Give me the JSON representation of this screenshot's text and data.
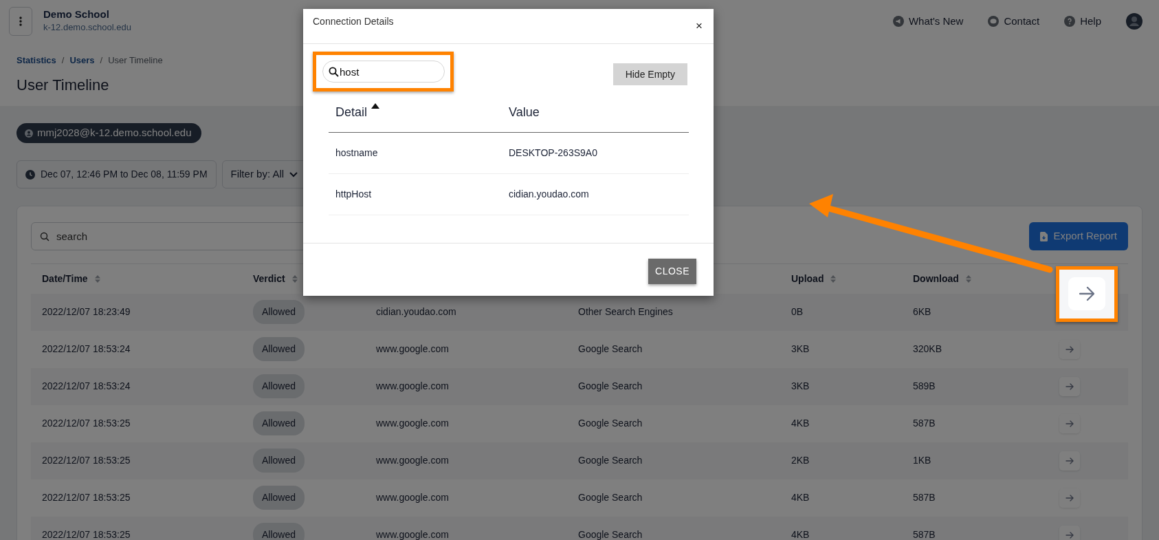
{
  "header": {
    "org_name": "Demo School",
    "org_domain": "k-12.demo.school.edu",
    "links": [
      {
        "label": "What's New",
        "kind": "news"
      },
      {
        "label": "Contact",
        "kind": "chat"
      },
      {
        "label": "Help",
        "kind": "help"
      }
    ]
  },
  "breadcrumb": [
    {
      "label": "Statistics",
      "current": false
    },
    {
      "label": "Users",
      "current": false,
      "separator": "/"
    },
    {
      "label": "User Timeline",
      "current": true,
      "separator": "/"
    }
  ],
  "title": "User Timeline",
  "user_chip": "mmj2028@k-12.demo.school.edu",
  "date_range": "Dec 07, 12:46 PM to Dec 08, 11:59 PM",
  "filter": "Filter by: All",
  "search": {
    "placeholder": "search"
  },
  "export_button": "Export Report",
  "table": {
    "columns": [
      {
        "label": "Date/Time"
      },
      {
        "label": "Verdict"
      },
      {
        "label": "Upload"
      },
      {
        "label": "Download"
      }
    ],
    "rows": [
      {
        "date_time": "2022/12/07 18:23:49",
        "verdict": "Allowed",
        "domain": "cidian.youdao.com",
        "category": "Other Search Engines",
        "upload": "0B",
        "download": "6KB",
        "highlighted": true
      },
      {
        "date_time": "2022/12/07 18:53:24",
        "verdict": "Allowed",
        "domain": "www.google.com",
        "category": "Google Search",
        "upload": "3KB",
        "download": "320KB",
        "highlighted": false
      },
      {
        "date_time": "2022/12/07 18:53:24",
        "verdict": "Allowed",
        "domain": "www.google.com",
        "category": "Google Search",
        "upload": "3KB",
        "download": "589B",
        "highlighted": false
      },
      {
        "date_time": "2022/12/07 18:53:25",
        "verdict": "Allowed",
        "domain": "www.google.com",
        "category": "Google Search",
        "upload": "4KB",
        "download": "587B",
        "highlighted": false
      },
      {
        "date_time": "2022/12/07 18:53:25",
        "verdict": "Allowed",
        "domain": "www.google.com",
        "category": "Google Search",
        "upload": "2KB",
        "download": "1KB",
        "highlighted": false
      },
      {
        "date_time": "2022/12/07 18:53:25",
        "verdict": "Allowed",
        "domain": "www.google.com",
        "category": "Google Search",
        "upload": "4KB",
        "download": "587B",
        "highlighted": false
      },
      {
        "date_time": "2022/12/07 18:53:25",
        "verdict": "Allowed",
        "domain": "www.google.com",
        "category": "Google Search",
        "upload": "4KB",
        "download": "587B",
        "highlighted": false
      }
    ]
  },
  "modal": {
    "title": "Connection Details",
    "close_icon": "×",
    "search": {
      "value": "host",
      "highlighted": true
    },
    "hide_empty_button": "Hide Empty",
    "columns": [
      {
        "label": "Detail",
        "sorted": true
      },
      {
        "label": "Value",
        "sorted": false
      }
    ],
    "rows": [
      {
        "detail": "hostname",
        "value": "DESKTOP-263S9A0"
      },
      {
        "detail": "httpHost",
        "value": "cidian.youdao.com"
      }
    ],
    "close_button": "CLOSE"
  }
}
